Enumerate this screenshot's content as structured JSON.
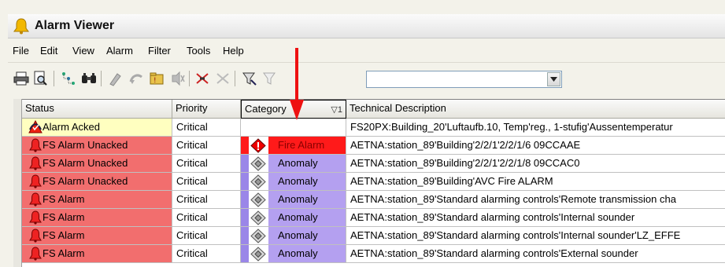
{
  "window": {
    "title": "Alarm Viewer"
  },
  "menu": [
    "File",
    "Edit",
    "View",
    "Alarm",
    "Filter",
    "Tools",
    "Help"
  ],
  "toolbar": {
    "icons": [
      "print-icon",
      "print-preview-icon",
      "tree-icon",
      "binoculars-icon",
      "acknowledge-icon",
      "reset-icon",
      "open-icon",
      "silence-icon",
      "mute-icon",
      "unmute-icon",
      "filter-icon",
      "clear-filter-icon"
    ],
    "filter_value": ""
  },
  "columns": {
    "status": "Status",
    "priority": "Priority",
    "category": "Category",
    "category_sort": "1",
    "description": "Technical Description"
  },
  "rows": [
    {
      "status": "Alarm Acked",
      "priority": "Critical",
      "category": "",
      "description": "FS20PX:Building_20'Luftaufb.10, Temp'reg., 1-stufig'Aussentemperatur"
    },
    {
      "status": "FS Alarm Unacked",
      "priority": "Critical",
      "category": "Fire Alarm",
      "description": "AETNA:station_89'Building'2/2/1'2/2/1/6 09CCAAE"
    },
    {
      "status": "FS Alarm Unacked",
      "priority": "Critical",
      "category": "Anomaly",
      "description": "AETNA:station_89'Building'2/2/1'2/2/1/8 09CCAC0"
    },
    {
      "status": "FS Alarm Unacked",
      "priority": "Critical",
      "category": "Anomaly",
      "description": "AETNA:station_89'Building'AVC Fire ALARM"
    },
    {
      "status": "FS Alarm",
      "priority": "Critical",
      "category": "Anomaly",
      "description": "AETNA:station_89'Standard alarming controls'Remote transmission cha"
    },
    {
      "status": "FS Alarm",
      "priority": "Critical",
      "category": "Anomaly",
      "description": "AETNA:station_89'Standard alarming controls'Internal sounder"
    },
    {
      "status": "FS Alarm",
      "priority": "Critical",
      "category": "Anomaly",
      "description": "AETNA:station_89'Standard alarming controls'Internal sounder'LZ_EFFE"
    },
    {
      "status": "FS Alarm",
      "priority": "Critical",
      "category": "Anomaly",
      "description": "AETNA:station_89'Standard alarming controls'External sounder"
    }
  ],
  "colors": {
    "acked_bg": "#ffffc0",
    "alarm_bg": "#f26e6e",
    "fire_bg": "#ff1a1a",
    "anomaly_bg": "#b4a0f0",
    "anomaly_stripe": "#9a86e8",
    "arrow": "#ee1111"
  }
}
